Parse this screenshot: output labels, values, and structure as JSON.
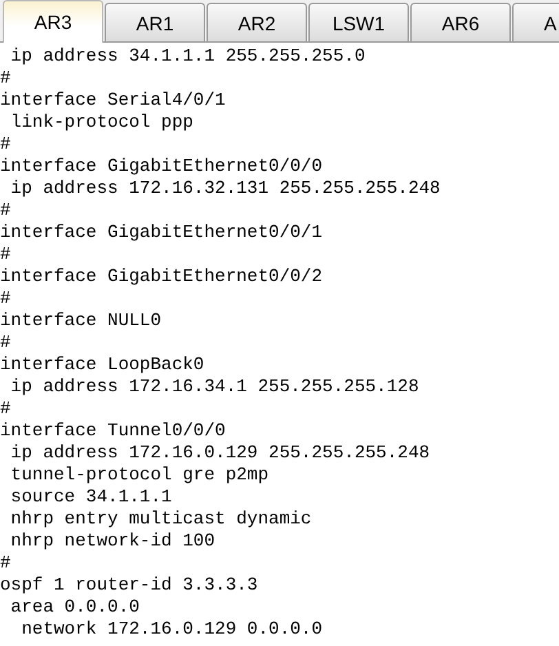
{
  "tabs": [
    {
      "label": "AR3",
      "selected": true
    },
    {
      "label": "AR1",
      "selected": false
    },
    {
      "label": "AR2",
      "selected": false
    },
    {
      "label": "LSW1",
      "selected": false
    },
    {
      "label": "AR6",
      "selected": false
    },
    {
      "label": "A",
      "selected": false
    }
  ],
  "console_lines": [
    " ip address 34.1.1.1 255.255.255.0",
    "#",
    "interface Serial4/0/1",
    " link-protocol ppp",
    "#",
    "interface GigabitEthernet0/0/0",
    " ip address 172.16.32.131 255.255.255.248",
    "#",
    "interface GigabitEthernet0/0/1",
    "#",
    "interface GigabitEthernet0/0/2",
    "#",
    "interface NULL0",
    "#",
    "interface LoopBack0",
    " ip address 172.16.34.1 255.255.255.128",
    "#",
    "interface Tunnel0/0/0",
    " ip address 172.16.0.129 255.255.255.248",
    " tunnel-protocol gre p2mp",
    " source 34.1.1.1",
    " nhrp entry multicast dynamic",
    " nhrp network-id 100",
    "#",
    "ospf 1 router-id 3.3.3.3",
    " area 0.0.0.0",
    "  network 172.16.0.129 0.0.0.0"
  ]
}
